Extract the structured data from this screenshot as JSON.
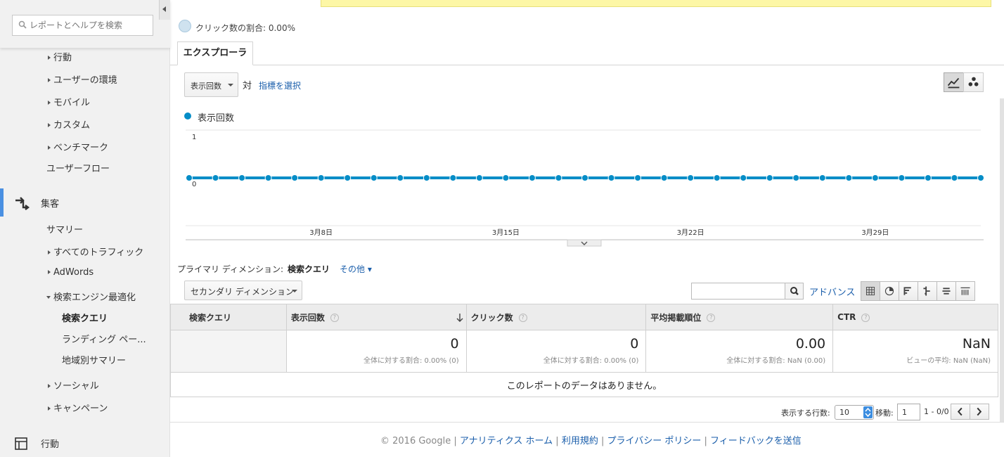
{
  "sidebar": {
    "search_placeholder": "レポートとヘルプを検索",
    "items": [
      {
        "label": "行動"
      },
      {
        "label": "ユーザーの環境"
      },
      {
        "label": "モバイル"
      },
      {
        "label": "カスタム"
      },
      {
        "label": "ベンチマーク"
      },
      {
        "label": "ユーザーフロー"
      }
    ],
    "acquisition": {
      "label": "集客",
      "items": [
        {
          "label": "サマリー"
        },
        {
          "label": "すべてのトラフィック"
        },
        {
          "label": "AdWords"
        },
        {
          "label": "検索エンジン最適化"
        },
        {
          "label": "検索クエリ"
        },
        {
          "label": "ランディング ペー..."
        },
        {
          "label": "地域別サマリー"
        },
        {
          "label": "ソーシャル"
        },
        {
          "label": "キャンペーン"
        }
      ]
    },
    "behavior_section": {
      "label": "行動"
    }
  },
  "summary": {
    "clicks_share": "クリック数の割合: 0.00%"
  },
  "tabs": {
    "explorer": "エクスプローラ"
  },
  "controls": {
    "metric": "表示回数",
    "vs": "対",
    "pick_metric": "指標を選択"
  },
  "chart_data": {
    "type": "line",
    "series": [
      {
        "name": "表示回数",
        "values": [
          0,
          0,
          0,
          0,
          0,
          0,
          0,
          0,
          0,
          0,
          0,
          0,
          0,
          0,
          0,
          0,
          0,
          0,
          0,
          0,
          0,
          0,
          0,
          0,
          0,
          0,
          0,
          0,
          0,
          0,
          0
        ]
      }
    ],
    "yticks": [
      "1",
      "0"
    ],
    "xtick_labels": [
      "3月8日",
      "3月15日",
      "3月22日",
      "3月29日"
    ],
    "ylim": [
      0,
      1
    ],
    "color": "#058dc7",
    "grid": true,
    "legend": "top-left"
  },
  "dimension": {
    "primary_label": "プライマリ ディメンション:",
    "primary_value": "検索クエリ",
    "other": "その他",
    "secondary": "セカンダリ ディメンション"
  },
  "table_tools": {
    "advance": "アドバンス",
    "search_value": ""
  },
  "table": {
    "headers": [
      "検索クエリ",
      "表示回数",
      "クリック数",
      "平均掲載順位",
      "CTR"
    ],
    "totals": [
      {
        "value": "0",
        "sub": "全体に対する割合: 0.00% (0)"
      },
      {
        "value": "0",
        "sub": "全体に対する割合: 0.00% (0)"
      },
      {
        "value": "0.00",
        "sub": "全体に対する割合: NaN (0.00)"
      },
      {
        "value": "NaN",
        "sub": "ビューの平均: NaN (NaN)"
      }
    ],
    "empty_message": "このレポートのデータはありません。"
  },
  "pagination": {
    "rows_label": "表示する行数:",
    "rows_value": "10",
    "goto_label": "移動:",
    "goto_value": "1",
    "range": "1 - 0/0"
  },
  "footer": {
    "copyright": "© 2016 Google",
    "links": [
      "アナリティクス ホーム",
      "利用規約",
      "プライバシー ポリシー",
      "フィードバックを送信"
    ]
  }
}
